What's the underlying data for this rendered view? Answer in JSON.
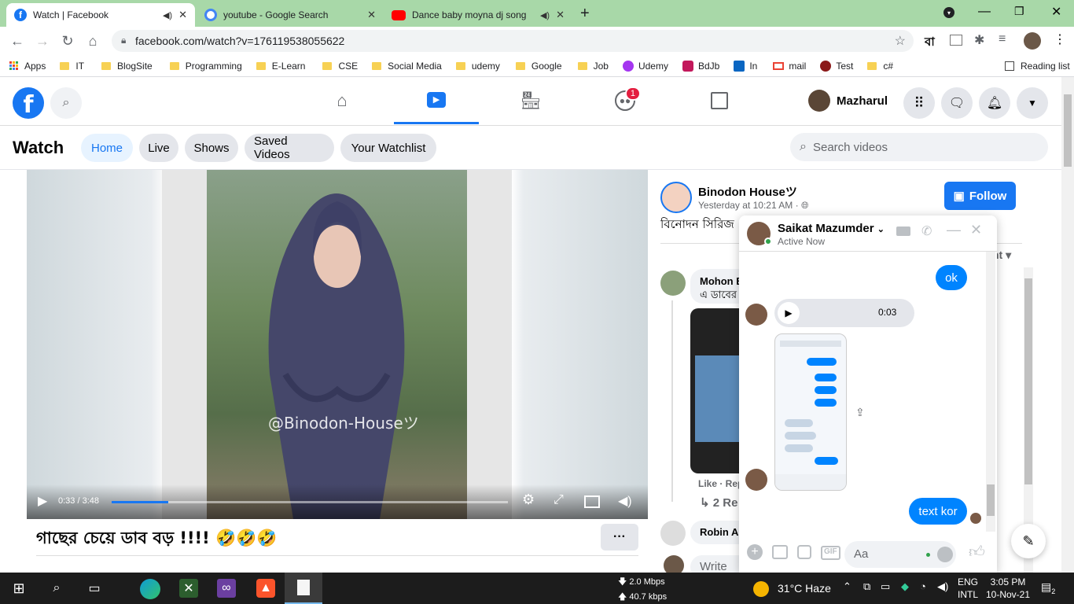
{
  "browser": {
    "tabs": [
      {
        "title": "Watch | Facebook",
        "color": "#1877f2",
        "sound": true
      },
      {
        "title": "youtube - Google Search",
        "color": "#4285f4",
        "sound": false
      },
      {
        "title": "Dance baby moyna dj song",
        "color": "#ff0000",
        "sound": true
      }
    ],
    "new_tab": "+",
    "url": "facebook.com/watch?v=176119538055622",
    "ext_label": "বা",
    "bookmarks": [
      "Apps",
      "IT",
      "BlogSite",
      "Programming",
      "E-Learn",
      "CSE",
      "Social Media",
      "udemy",
      "Google",
      "Job",
      "Udemy",
      "BdJb",
      "In",
      "mail",
      "Test",
      "c#"
    ],
    "reading_list": "Reading list"
  },
  "fb_header": {
    "logo": "f",
    "notif_count": "1",
    "user_name": "Mazharul"
  },
  "watch": {
    "title": "Watch",
    "tabs": [
      "Home",
      "Live",
      "Shows",
      "Saved Videos",
      "Your Watchlist"
    ],
    "search_placeholder": "Search videos"
  },
  "video": {
    "watermark": "@Binodon-Houseツ",
    "time": "0:33 / 3:48",
    "progress": 0.142,
    "title": "গাছের চেয়ে ডাব বড় !!!! 🤣🤣🤣",
    "more": "···"
  },
  "post": {
    "page_name": "Binodon Houseツ",
    "timestamp": "Yesterday at 10:21 AM ·",
    "follow": "Follow",
    "caption": "বিনোদন সিরিজ",
    "sort_fragment": "nt",
    "comments": [
      {
        "name": "Mohon B",
        "text": "এ ডাবের",
        "like": "Like · Rep",
        "replies": "2 Re"
      },
      {
        "name": "Robin Ah"
      }
    ],
    "write": "Write a"
  },
  "chat": {
    "name": "Saikat Mazumder",
    "status": "Active Now",
    "msg_ok": "ok",
    "audio_time": "0:03",
    "msg_text": "text kor",
    "input_placeholder": "Aa",
    "gif": "GIF"
  },
  "taskbar": {
    "net_down": "2.0 Mbps",
    "net_up": "40.7 kbps",
    "weather": "31°C  Haze",
    "lang1": "ENG",
    "lang2": "INTL",
    "time": "3:05 PM",
    "date": "10-Nov-21",
    "notif": "2"
  }
}
